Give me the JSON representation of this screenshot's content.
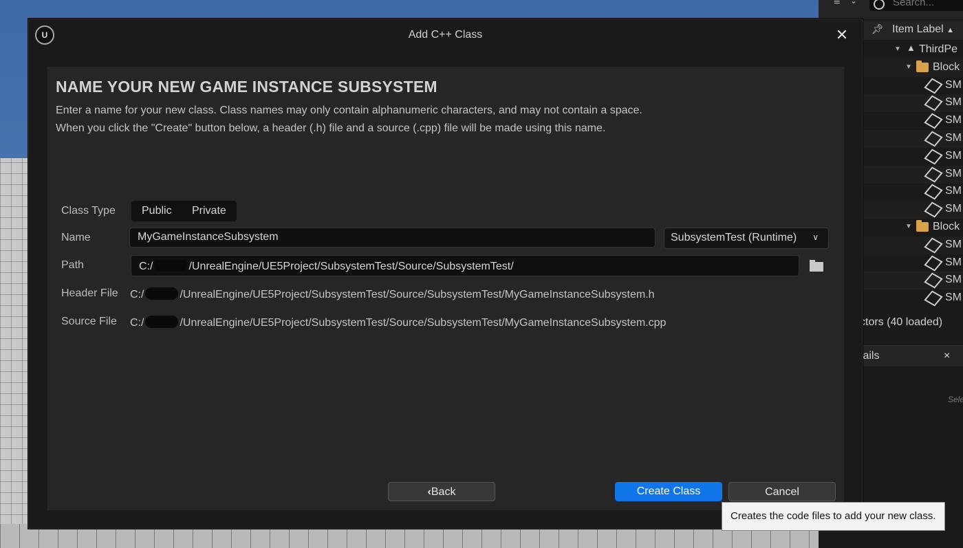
{
  "dialog": {
    "title": "Add C++ Class",
    "logo_text": "U",
    "close_glyph": "✕",
    "heading": "NAME YOUR NEW GAME INSTANCE SUBSYSTEM",
    "description_line1": "Enter a name for your new class. Class names may only contain alphanumeric characters, and may not contain a space.",
    "description_line2": "When you click the \"Create\" button below, a header (.h) file and a source (.cpp) file will be made using this name.",
    "fields": {
      "class_type_label": "Class Type",
      "class_type_options": [
        "Public",
        "Private"
      ],
      "name_label": "Name",
      "name_value": "MyGameInstanceSubsystem",
      "module_value": "SubsystemTest (Runtime)",
      "path_label": "Path",
      "path_prefix": "C:/",
      "path_suffix": "/UnrealEngine/UE5Project/SubsystemTest/Source/SubsystemTest/",
      "header_label": "Header File",
      "header_prefix": "C:/",
      "header_suffix": "/UnrealEngine/UE5Project/SubsystemTest/Source/SubsystemTest/MyGameInstanceSubsystem.h",
      "source_label": "Source File",
      "source_prefix": "C:/",
      "source_suffix": "/UnrealEngine/UE5Project/SubsystemTest/Source/SubsystemTest/MyGameInstanceSubsystem.cpp"
    },
    "buttons": {
      "back": "Back",
      "create": "Create Class",
      "cancel": "Cancel"
    },
    "tooltip": "Creates the code files to add your new class."
  },
  "outliner": {
    "search_placeholder": "Search...",
    "column_label": "Item Label",
    "sort_glyph": "▲",
    "rows": [
      {
        "label": "ThirdPe",
        "kind": "world"
      },
      {
        "label": "Block",
        "kind": "folder"
      },
      {
        "label": "SM",
        "kind": "mesh"
      },
      {
        "label": "SM",
        "kind": "mesh"
      },
      {
        "label": "SM",
        "kind": "mesh"
      },
      {
        "label": "SM",
        "kind": "mesh"
      },
      {
        "label": "SM",
        "kind": "mesh"
      },
      {
        "label": "SM",
        "kind": "mesh"
      },
      {
        "label": "SM",
        "kind": "mesh"
      },
      {
        "label": "SM",
        "kind": "mesh"
      },
      {
        "label": "Block",
        "kind": "folder"
      },
      {
        "label": "SM",
        "kind": "mesh"
      },
      {
        "label": "SM",
        "kind": "mesh"
      },
      {
        "label": "SM",
        "kind": "mesh"
      },
      {
        "label": "SM",
        "kind": "mesh"
      }
    ],
    "actors_loaded": "ctors (40 loaded)",
    "details_tab": "tails",
    "details_close": "×",
    "select_hint": "Sele"
  },
  "colors": {
    "accent": "#0f75e8",
    "dialog_bg": "#1a1a1a",
    "panel_bg": "#262626"
  }
}
